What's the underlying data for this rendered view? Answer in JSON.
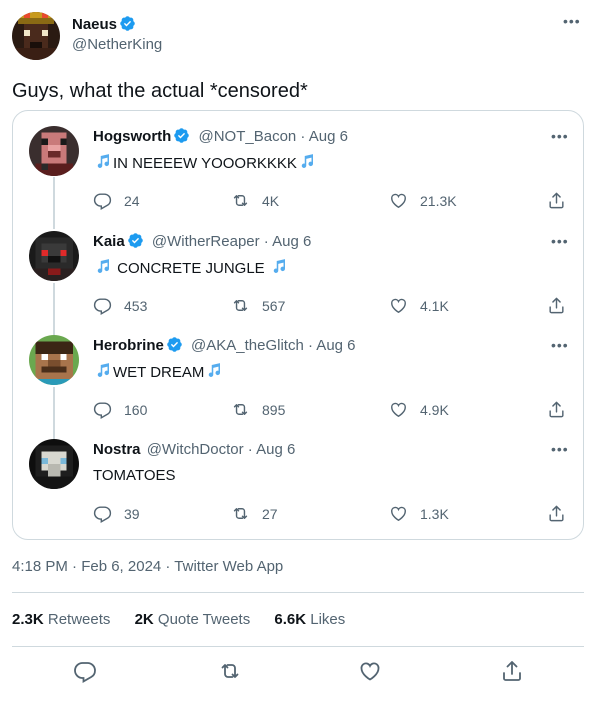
{
  "main_tweet": {
    "author_name": "Naeus",
    "author_handle": "@NetherKing",
    "text": "Guys, what the actual *censored*",
    "timestamp": "4:18 PM · Feb 6, 2024 · Twitter Web App",
    "stats": {
      "retweets_count": "2.3K",
      "retweets_label": "Retweets",
      "quote_count": "2K",
      "quote_label": "Quote Tweets",
      "likes_count": "6.6K",
      "likes_label": "Likes"
    }
  },
  "quoted_thread": [
    {
      "name": "Hogsworth",
      "verified": true,
      "handle_date": "@NOT_Bacon · Aug 6",
      "text": "IN NEEEEW YOOORKKKK",
      "replies": "24",
      "retweets": "4K",
      "likes": "21.3K"
    },
    {
      "name": "Kaia",
      "verified": true,
      "handle_date": "@WitherReaper · Aug 6",
      "text": "CONCRETE JUNGLE",
      "replies": "453",
      "retweets": "567",
      "likes": "4.1K"
    },
    {
      "name": "Herobrine",
      "verified": true,
      "handle_date": "@AKA_theGlitch · Aug 6",
      "text": "WET DREAM",
      "replies": "160",
      "retweets": "895",
      "likes": "4.9K"
    },
    {
      "name": "Nostra",
      "verified": false,
      "handle_date": "@WitchDoctor · Aug 6",
      "text": "TOMATOES",
      "replies": "39",
      "retweets": "27",
      "likes": "1.3K"
    }
  ],
  "icons": {
    "verified": "verified-badge-icon",
    "more": "more-icon",
    "reply": "reply-icon",
    "retweet": "retweet-icon",
    "like": "like-icon",
    "share": "share-icon",
    "music": "music-notes-icon"
  },
  "colors": {
    "verified_blue": "#1d9bf0",
    "text_primary": "#0f1419",
    "text_secondary": "#536471",
    "border": "#cfd9de"
  }
}
